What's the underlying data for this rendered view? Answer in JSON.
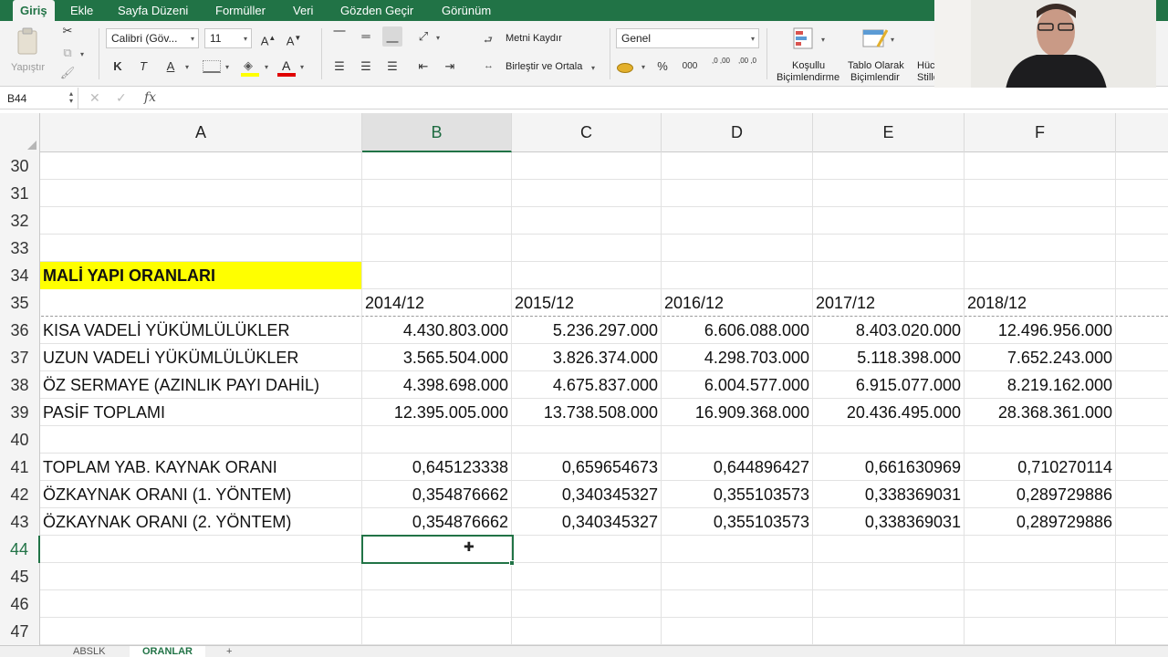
{
  "ribbon_tabs": [
    "Giriş",
    "Ekle",
    "Sayfa Düzeni",
    "Formüller",
    "Veri",
    "Gözden Geçir",
    "Görünüm"
  ],
  "ribbon": {
    "paste_label": "Yapıştır",
    "font_name": "Calibri (Göv...",
    "font_size": "11",
    "wrap_text": "Metni Kaydır",
    "merge_center": "Birleştir ve Ortala",
    "number_format": "Genel",
    "conditional_formatting": [
      "Koşullu",
      "Biçimlendirme"
    ],
    "format_as_table": [
      "Tablo Olarak",
      "Biçimlendir"
    ],
    "cell_styles": [
      "Hücr",
      "Stille"
    ],
    "percent": "%",
    "thousands": "000",
    "increase_decimal": ",0 ,00",
    "decrease_decimal": ",00 ,0"
  },
  "formula_bar": {
    "name_box": "B44",
    "fx": "fx",
    "formula": ""
  },
  "columns": [
    "A",
    "B",
    "C",
    "D",
    "E",
    "F"
  ],
  "selected_column": "B",
  "rows": [
    {
      "n": "30",
      "cells": [
        "",
        "",
        "",
        "",
        "",
        ""
      ]
    },
    {
      "n": "31",
      "cells": [
        "",
        "",
        "",
        "",
        "",
        ""
      ]
    },
    {
      "n": "32",
      "cells": [
        "",
        "",
        "",
        "",
        "",
        ""
      ]
    },
    {
      "n": "33",
      "cells": [
        "",
        "",
        "",
        "",
        "",
        ""
      ]
    },
    {
      "n": "34",
      "cells": [
        "MALİ YAPI ORANLARI",
        "",
        "",
        "",
        "",
        ""
      ]
    },
    {
      "n": "35",
      "cells": [
        "",
        "2014/12",
        "2015/12",
        "2016/12",
        "2017/12",
        "2018/12"
      ]
    },
    {
      "n": "36",
      "cells": [
        "KISA VADELİ YÜKÜMLÜLÜKLER",
        "4.430.803.000",
        "5.236.297.000",
        "6.606.088.000",
        "8.403.020.000",
        "12.496.956.000"
      ]
    },
    {
      "n": "37",
      "cells": [
        "UZUN VADELİ YÜKÜMLÜLÜKLER",
        "3.565.504.000",
        "3.826.374.000",
        "4.298.703.000",
        "5.118.398.000",
        "7.652.243.000"
      ]
    },
    {
      "n": "38",
      "cells": [
        "ÖZ SERMAYE (AZINLIK PAYI DAHİL)",
        "4.398.698.000",
        "4.675.837.000",
        "6.004.577.000",
        "6.915.077.000",
        "8.219.162.000"
      ]
    },
    {
      "n": "39",
      "cells": [
        "PASİF TOPLAMI",
        "12.395.005.000",
        "13.738.508.000",
        "16.909.368.000",
        "20.436.495.000",
        "28.368.361.000"
      ]
    },
    {
      "n": "40",
      "cells": [
        "",
        "",
        "",
        "",
        "",
        ""
      ]
    },
    {
      "n": "41",
      "cells": [
        "TOPLAM YAB. KAYNAK ORANI",
        "0,645123338",
        "0,659654673",
        "0,644896427",
        "0,661630969",
        "0,710270114"
      ]
    },
    {
      "n": "42",
      "cells": [
        "ÖZKAYNAK ORANI (1. YÖNTEM)",
        "0,354876662",
        "0,340345327",
        "0,355103573",
        "0,338369031",
        "0,289729886"
      ]
    },
    {
      "n": "43",
      "cells": [
        "ÖZKAYNAK ORANI (2. YÖNTEM)",
        "0,354876662",
        "0,340345327",
        "0,355103573",
        "0,338369031",
        "0,289729886"
      ]
    },
    {
      "n": "44",
      "cells": [
        "",
        "",
        "",
        "",
        "",
        ""
      ]
    },
    {
      "n": "45",
      "cells": [
        "",
        "",
        "",
        "",
        "",
        ""
      ]
    },
    {
      "n": "46",
      "cells": [
        "",
        "",
        "",
        "",
        "",
        ""
      ]
    },
    {
      "n": "47",
      "cells": [
        "",
        "",
        "",
        "",
        "",
        ""
      ]
    }
  ],
  "active_cell": "B44",
  "sheet_tabs": [
    "ABSLK",
    "ORANLAR",
    "+"
  ],
  "active_sheet": "ORANLAR",
  "colors": {
    "excel_green": "#217346",
    "highlight_yellow": "#ffff00"
  }
}
